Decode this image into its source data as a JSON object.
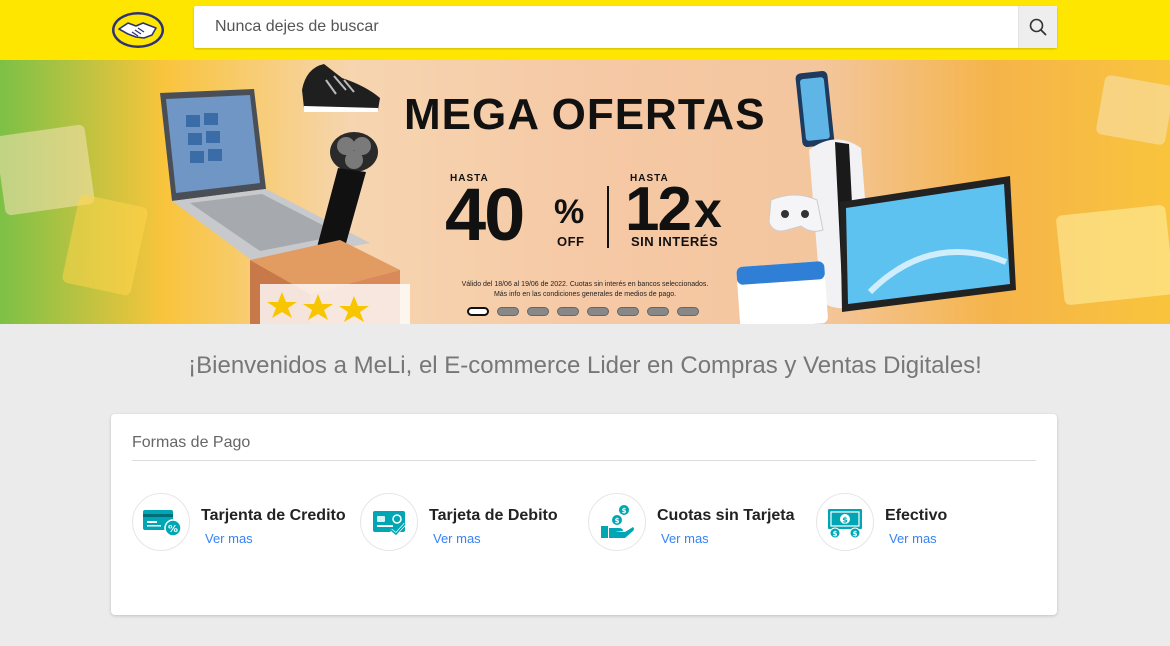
{
  "header": {
    "search_placeholder": "Nunca dejes de buscar",
    "logo_icon": "handshake-logo-icon",
    "search_icon": "search-icon",
    "brand_color": "#ffe600"
  },
  "banner": {
    "title": "MEGA OFERTAS",
    "left_hasta": "HASTA",
    "left_value": "40",
    "left_percent": "%",
    "left_sub": "OFF",
    "right_hasta": "HASTA",
    "right_value": "12",
    "right_x": "x",
    "right_sub": "SIN INTERÉS",
    "legal_line1": "Válido del 18/06 al 19/06 de 2022. Cuotas sin interés en bancos seleccionados.",
    "legal_line2": "Más info en las condiciones generales de medios de pago.",
    "slide_count": 8,
    "active_slide": 1
  },
  "welcome": "¡Bienvenidos a MeLi, el E-commerce Lider en Compras y Ventas Digitales!",
  "payments": {
    "title": "Formas de Pago",
    "accent_color": "#00a6b4",
    "link_color": "#3483fa",
    "items": [
      {
        "label": "Tarjenta de Credito",
        "link": "Ver mas",
        "icon": "credit-card-icon"
      },
      {
        "label": "Tarjeta de Debito",
        "link": "Ver mas",
        "icon": "debit-card-icon"
      },
      {
        "label": "Cuotas sin Tarjeta",
        "link": "Ver mas",
        "icon": "hand-coins-icon"
      },
      {
        "label": "Efectivo",
        "link": "Ver mas",
        "icon": "cash-icon"
      }
    ]
  }
}
